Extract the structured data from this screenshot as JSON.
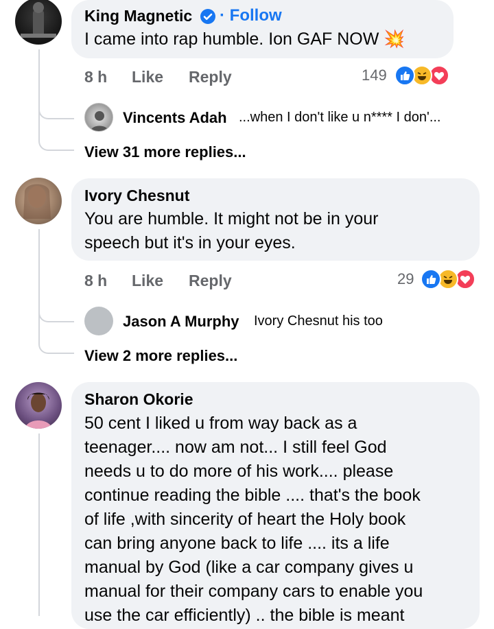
{
  "comments": [
    {
      "author": "King Magnetic",
      "verified": true,
      "follow_label": "· Follow",
      "text": "I came into rap humble. Ion GAF NOW",
      "emoji": "💥",
      "time": "8 h",
      "like_label": "Like",
      "reply_label": "Reply",
      "reaction_count": "149",
      "reply_preview": {
        "author": "Vincents Adah",
        "text": "...when I don't like u n**** I don'..."
      },
      "more_replies": "View 31 more replies..."
    },
    {
      "author": "Ivory Chesnut",
      "text_lines": [
        "You are humble. It might not be in your",
        "speech but it's in your eyes."
      ],
      "time": "8 h",
      "like_label": "Like",
      "reply_label": "Reply",
      "reaction_count": "29",
      "reply_preview": {
        "author": "Jason A Murphy",
        "text": "Ivory Chesnut his too"
      },
      "more_replies": "View 2 more replies..."
    },
    {
      "author": "Sharon Okorie",
      "text_lines": [
        "50 cent I liked u from way back as a",
        "teenager.... now am not... I still feel God",
        "needs u to do more of his work.... please",
        "continue reading the bible .... that's the book",
        "of life ,with sincerity of heart the Holy book",
        "can bring anyone back to life .... its a life",
        "manual by God (like a car company gives u",
        "manual for their company cars to enable you",
        "use the car efficiently) .. the bible is meant"
      ]
    }
  ],
  "colors": {
    "bubble": "#f0f2f5",
    "link": "#1877f2",
    "meta": "#65676b",
    "like": "#1877f2",
    "haha": "#f7b928",
    "love": "#f33e58"
  },
  "icons": [
    "verified-badge-icon",
    "like-reaction-icon",
    "haha-reaction-icon",
    "love-reaction-icon"
  ]
}
